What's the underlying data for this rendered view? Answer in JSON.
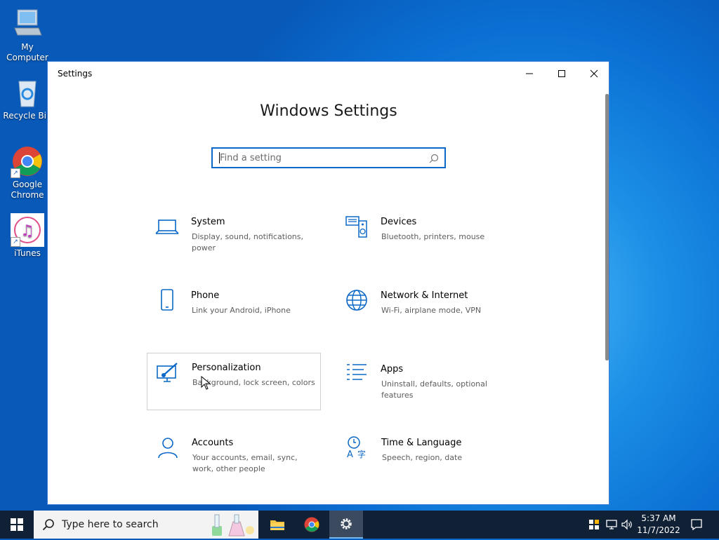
{
  "desktop": {
    "icons": [
      {
        "label": "My Computer"
      },
      {
        "label": "Recycle Bin"
      },
      {
        "label": "Google Chrome"
      },
      {
        "label": "iTunes"
      }
    ]
  },
  "window": {
    "title": "Settings",
    "heading": "Windows Settings",
    "search_placeholder": "Find a setting",
    "tiles": [
      {
        "name": "System",
        "desc": "Display, sound, notifications, power"
      },
      {
        "name": "Devices",
        "desc": "Bluetooth, printers, mouse"
      },
      {
        "name": "Phone",
        "desc": "Link your Android, iPhone"
      },
      {
        "name": "Network & Internet",
        "desc": "Wi-Fi, airplane mode, VPN"
      },
      {
        "name": "Personalization",
        "desc": "Background, lock screen, colors"
      },
      {
        "name": "Apps",
        "desc": "Uninstall, defaults, optional features"
      },
      {
        "name": "Accounts",
        "desc": "Your accounts, email, sync, work, other people"
      },
      {
        "name": "Time & Language",
        "desc": "Speech, region, date"
      }
    ]
  },
  "taskbar": {
    "search_text": "Type here to search",
    "time": "5:37 AM",
    "date": "11/7/2022"
  },
  "colors": {
    "accent": "#0a68c6",
    "taskbar": "#102035"
  }
}
